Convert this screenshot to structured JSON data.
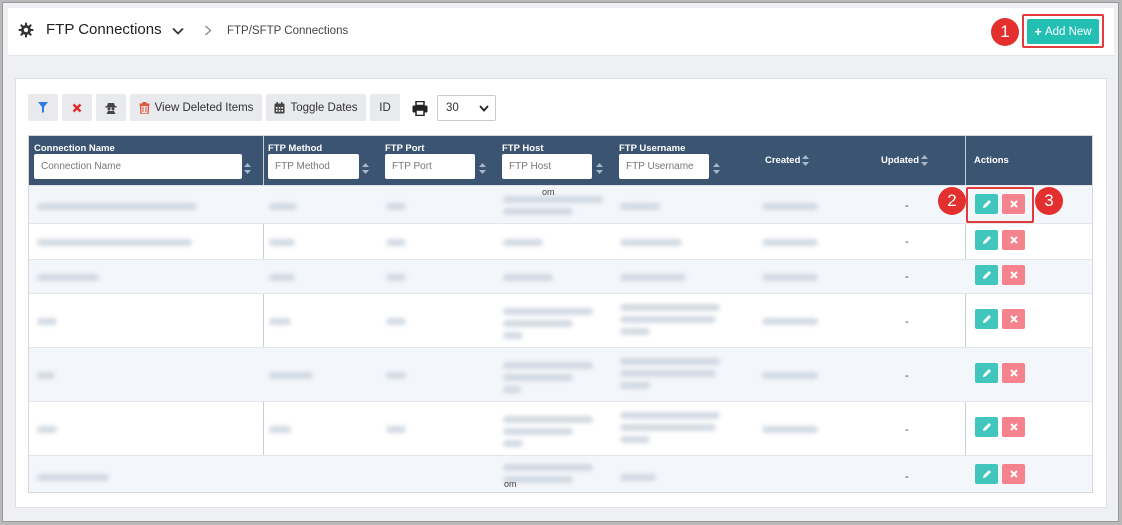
{
  "header": {
    "title": "FTP Connections",
    "breadcrumb": "FTP/SFTP Connections",
    "add_new_label": "Add New"
  },
  "callouts": [
    "1",
    "2",
    "3"
  ],
  "toolbar": {
    "view_deleted_label": "View Deleted Items",
    "toggle_dates_label": "Toggle Dates",
    "id_label": "ID",
    "page_size": "30"
  },
  "table": {
    "columns": [
      {
        "label": "Connection Name",
        "placeholder": "Connection Name"
      },
      {
        "label": "FTP Method",
        "placeholder": "FTP Method"
      },
      {
        "label": "FTP Port",
        "placeholder": "FTP Port"
      },
      {
        "label": "FTP Host",
        "placeholder": "FTP Host"
      },
      {
        "label": "FTP Username",
        "placeholder": "FTP Username"
      },
      {
        "label": "Created"
      },
      {
        "label": "Updated"
      },
      {
        "label": "Actions"
      }
    ],
    "rows": [
      {
        "updated": "-"
      },
      {
        "updated": "-"
      },
      {
        "updated": "-"
      },
      {
        "updated": "-"
      },
      {
        "updated": "-"
      },
      {
        "updated": "-"
      },
      {
        "updated": "-"
      }
    ],
    "overflow_fragments": [
      "om",
      "om"
    ]
  },
  "colors": {
    "accent": "#23bfb3",
    "header_bg": "#3b5472",
    "edit": "#41c6be",
    "delete": "#f4838d",
    "callout": "#e42f2f"
  },
  "icons": [
    "gear-icon",
    "chevron-down-icon",
    "chevron-right-icon",
    "plus-icon",
    "filter-icon",
    "close-icon",
    "user-secret-icon",
    "trash-icon",
    "calendar-icon",
    "print-icon",
    "sort-icon",
    "pencil-icon",
    "times-icon"
  ]
}
